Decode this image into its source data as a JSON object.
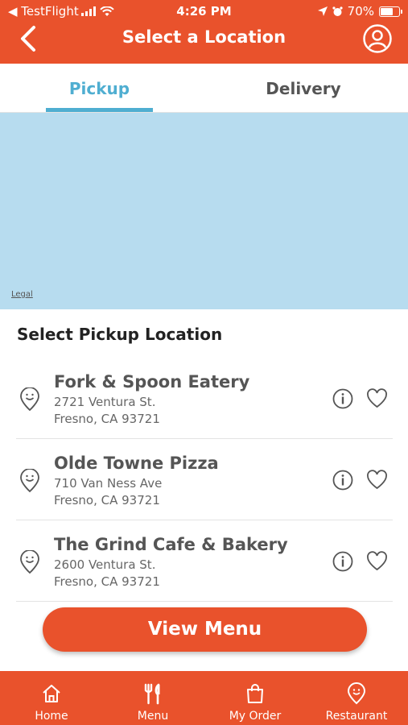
{
  "status_bar": {
    "back_app": "◀ TestFlight",
    "time": "4:26 PM",
    "battery": "70%",
    "battery_level": 0.7
  },
  "header": {
    "title": "Select a Location",
    "back_icon": "chevron-left-icon",
    "profile_icon": "user-circle-icon"
  },
  "tabs": [
    {
      "label": "Pickup",
      "active": true
    },
    {
      "label": "Delivery",
      "active": false
    }
  ],
  "map": {
    "legal_label": "Legal"
  },
  "section_title": "Select Pickup Location",
  "locations": [
    {
      "name": "Fork & Spoon Eatery",
      "address1": "2721 Ventura St.",
      "address2": "Fresno, CA 93721"
    },
    {
      "name": "Olde Towne Pizza",
      "address1": "710 Van Ness Ave",
      "address2": "Fresno, CA 93721"
    },
    {
      "name": "The Grind Cafe & Bakery",
      "address1": "2600 Ventura St.",
      "address2": "Fresno, CA 93721"
    }
  ],
  "primary_action": {
    "label": "View Menu"
  },
  "bottom_nav": [
    {
      "label": "Home",
      "icon": "home-icon"
    },
    {
      "label": "Menu",
      "icon": "fork-knife-icon"
    },
    {
      "label": "My Order",
      "icon": "shopping-bag-icon"
    },
    {
      "label": "Restaurant",
      "icon": "location-pin-icon"
    }
  ],
  "colors": {
    "brand": "#E9522C",
    "accent": "#4FAED1",
    "map": "#B7DCEF"
  }
}
